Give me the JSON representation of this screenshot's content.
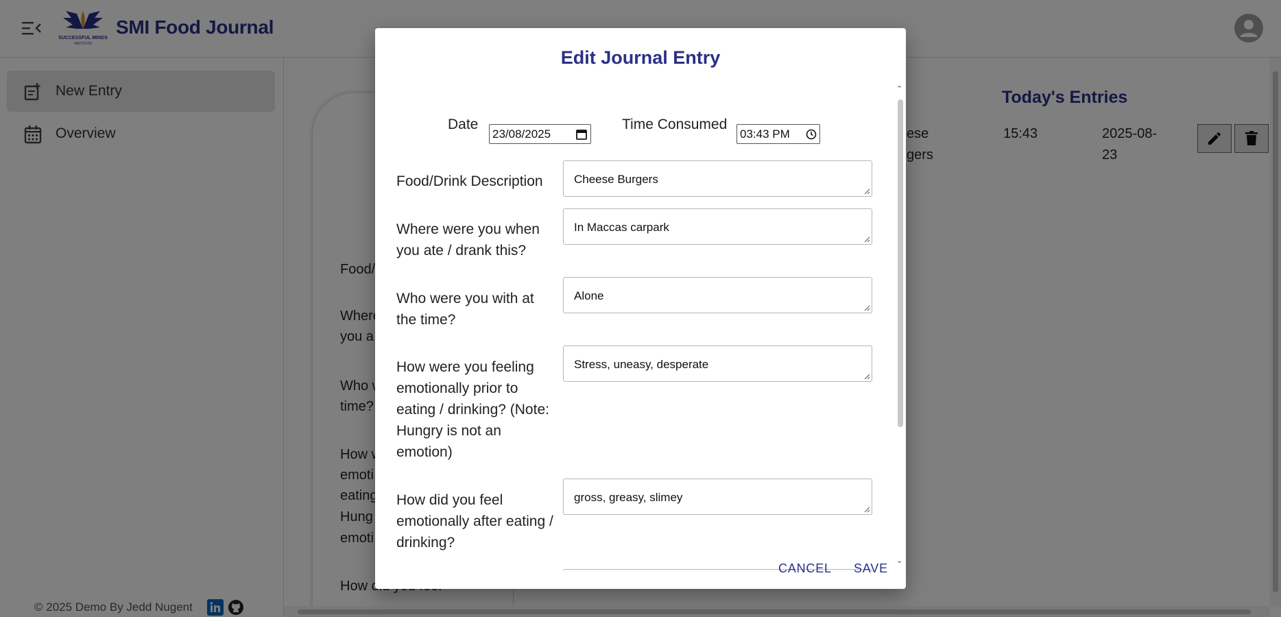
{
  "app": {
    "title": "SMI Food Journal",
    "logo_text": "SUCCESSFUL MINDS INSTITUTE"
  },
  "sidebar": {
    "items": [
      {
        "label": "New Entry",
        "icon": "note-add-icon",
        "active": true
      },
      {
        "label": "Overview",
        "icon": "calendar-icon",
        "active": false
      }
    ],
    "footer": "© 2025 Demo By Jedd Nugent"
  },
  "background_form": {
    "labels": [
      "Food/",
      "Where",
      "you a",
      "Who w",
      "time?",
      "How w",
      "emoti",
      "eating",
      "Hung",
      "emoti",
      "How did you feel"
    ]
  },
  "todays_entries": {
    "title": "Today's Entries",
    "rows": [
      {
        "food_line1": "ese",
        "food_line2": "gers",
        "time": "15:43",
        "date_line1": "2025-08-",
        "date_line2": "23"
      }
    ]
  },
  "dialog": {
    "title": "Edit Journal Entry",
    "date_label": "Date",
    "date_value": "23/08/2025",
    "time_label": "Time Consumed",
    "time_value": "03:43 PM",
    "fields": [
      {
        "label": "Food/Drink Description",
        "value": "Cheese Burgers"
      },
      {
        "label": "Where were you when you ate / drank this?",
        "value": "In Maccas carpark"
      },
      {
        "label": "Who were you with at the time?",
        "value": "Alone"
      },
      {
        "label": "How were you feeling emotionally prior to eating / drinking? (Note: Hungry is not an emotion)",
        "value": "Stress, uneasy, desperate"
      },
      {
        "label": "How did you feel emotionally after eating / drinking?",
        "value": "gross, greasy, slimey"
      }
    ],
    "cancel_label": "CANCEL",
    "save_label": "SAVE"
  },
  "colors": {
    "brand": "#2b2f87",
    "backdrop": "rgba(0,0,0,0.5)"
  }
}
